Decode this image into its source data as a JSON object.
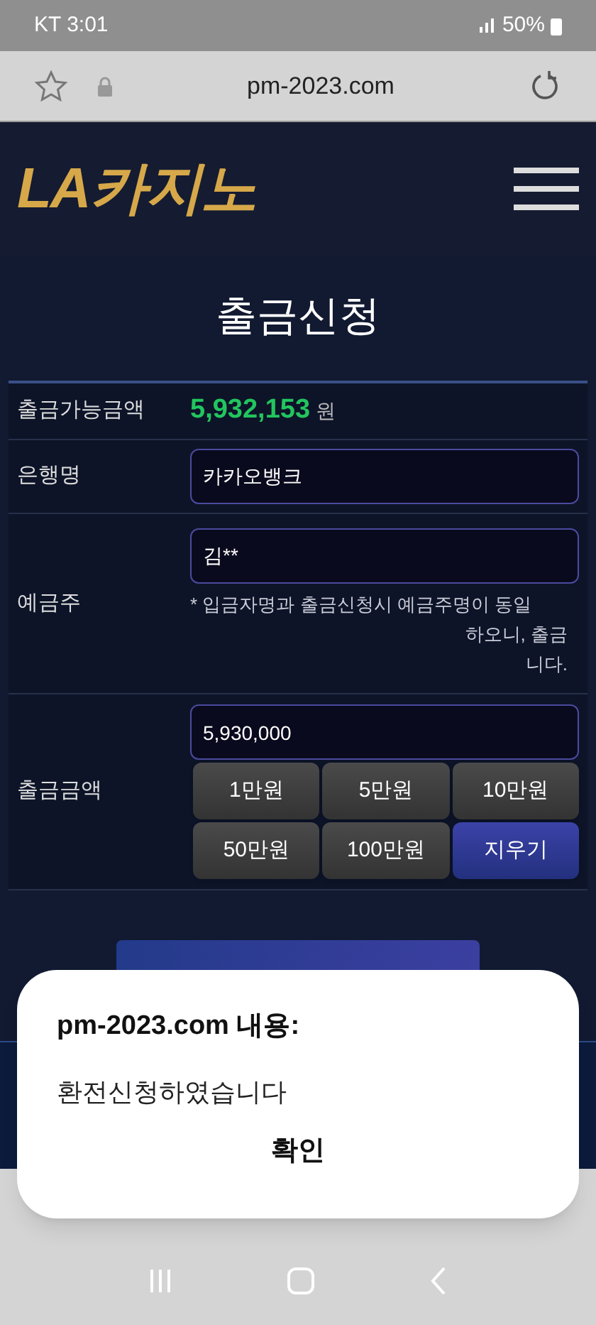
{
  "status_bar": {
    "carrier_time": "KT 3:01",
    "battery": "50%"
  },
  "browser": {
    "url": "pm-2023.com"
  },
  "header": {
    "logo": "LA카지노"
  },
  "page": {
    "title": "출금신청"
  },
  "form": {
    "available": {
      "label": "출금가능금액",
      "amount": "5,932,153",
      "unit": "원"
    },
    "bank": {
      "label": "은행명",
      "value": "카카오뱅크"
    },
    "holder": {
      "label": "예금주",
      "value": "김**",
      "note_lines": [
        "* 입금자명과 출금신청시 예금주명이 동일",
        "하오니, 출금",
        "니다."
      ]
    },
    "amount": {
      "label": "출금금액",
      "value": "5,930,000",
      "buttons": [
        {
          "label": "1만원",
          "kind": "add"
        },
        {
          "label": "5만원",
          "kind": "add"
        },
        {
          "label": "10만원",
          "kind": "add"
        },
        {
          "label": "50만원",
          "kind": "add"
        },
        {
          "label": "100만원",
          "kind": "add"
        },
        {
          "label": "지우기",
          "kind": "clear"
        }
      ]
    }
  },
  "dialog": {
    "title": "pm-2023.com 내용:",
    "message": "환전신청하였습니다",
    "button": "확인"
  }
}
